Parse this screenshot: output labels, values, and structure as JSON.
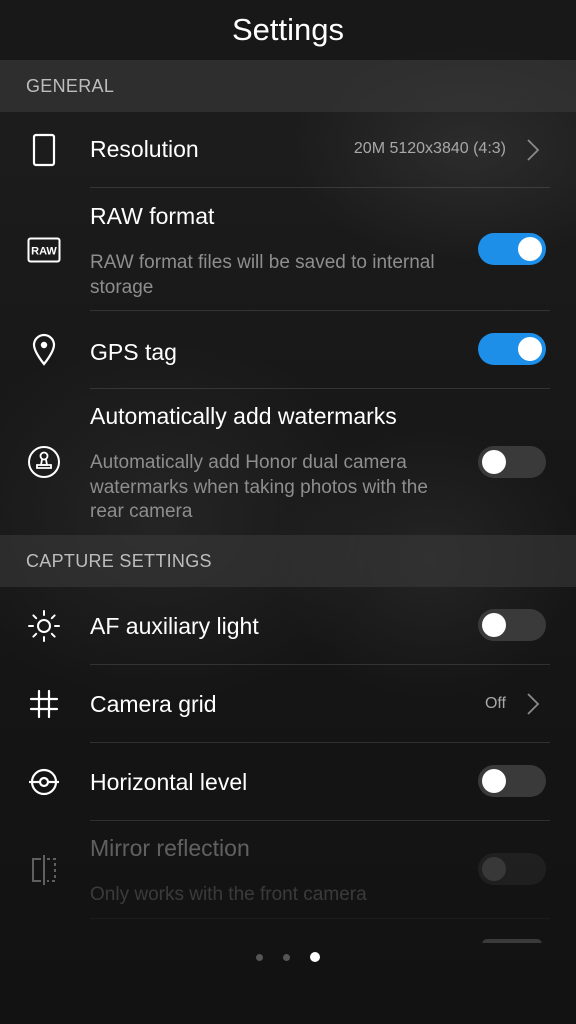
{
  "header": {
    "title": "Settings"
  },
  "sections": {
    "general": "GENERAL",
    "capture": "CAPTURE SETTINGS"
  },
  "rows": {
    "resolution": {
      "title": "Resolution",
      "value": "20M 5120x3840 (4:3)",
      "icon": "phone-outline-icon"
    },
    "raw": {
      "title": "RAW format",
      "desc": "RAW format files will be saved to internal storage",
      "toggle": "on",
      "icon_label": "RAW",
      "icon": "raw-icon"
    },
    "gps": {
      "title": "GPS tag",
      "toggle": "on",
      "icon": "location-pin-icon"
    },
    "watermark": {
      "title": "Automatically add watermarks",
      "desc": "Automatically add Honor dual camera watermarks when taking photos with the rear camera",
      "toggle": "off",
      "icon": "stamp-icon"
    },
    "af": {
      "title": "AF auxiliary light",
      "toggle": "off",
      "icon": "sun-icon"
    },
    "grid": {
      "title": "Camera grid",
      "value": "Off",
      "icon": "grid-icon"
    },
    "level": {
      "title": "Horizontal level",
      "toggle": "off",
      "icon": "level-icon"
    },
    "mirror": {
      "title": "Mirror reflection",
      "desc": "Only works with the front camera",
      "toggle": "off",
      "disabled": true,
      "icon": "mirror-icon"
    }
  },
  "pager": {
    "pages": 3,
    "active": 3
  },
  "colors": {
    "accent": "#1d8fe8",
    "background": "#161616",
    "section": "#3c3c3c"
  }
}
